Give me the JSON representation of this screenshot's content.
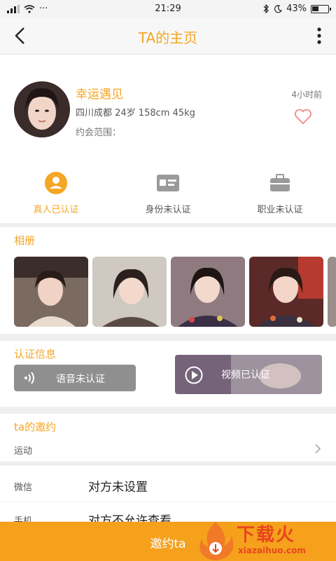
{
  "status_bar": {
    "time": "21:29",
    "battery": "43%",
    "carrier_dots": "···"
  },
  "nav": {
    "title": "TA的主页"
  },
  "profile": {
    "name": "幸运遇见",
    "info": "四川成都  24岁  158cm  45kg",
    "date_range_label": "约会范围：",
    "last_active": "4小时前"
  },
  "verification": [
    {
      "label": "真人已认证",
      "icon": "person-icon",
      "active": true
    },
    {
      "label": "身份未认证",
      "icon": "id-card-icon",
      "active": false
    },
    {
      "label": "职业未认证",
      "icon": "briefcase-icon",
      "active": false
    }
  ],
  "album": {
    "title": "相册",
    "photo_count": 5
  },
  "certification": {
    "title": "认证信息",
    "voice_label": "语音未认证",
    "video_label": "视频已认证"
  },
  "invite": {
    "title": "ta的邀约",
    "item": "运动"
  },
  "contact": [
    {
      "key": "微信",
      "value": "对方未设置"
    },
    {
      "key": "手机",
      "value": "对方不允许查看"
    }
  ],
  "bottom": {
    "button_label": "邀约ta"
  },
  "watermark": {
    "text": "下载火",
    "domain": "xiazaihuo.com"
  },
  "colors": {
    "accent": "#f5a623",
    "button": "#f5a11c",
    "logo": "#e8461e"
  }
}
